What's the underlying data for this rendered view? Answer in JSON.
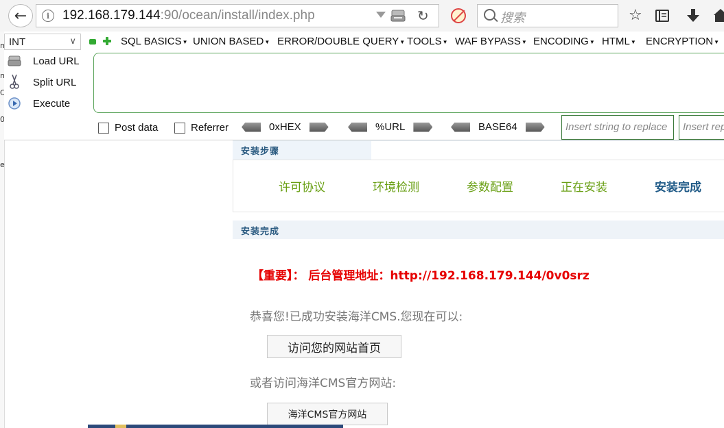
{
  "browser": {
    "url_host": "192.168.179.144",
    "url_rest": ":90/ocean/install/index.php",
    "search_placeholder": "搜索"
  },
  "hackbar": {
    "select_value": "INT",
    "menus": [
      "SQL BASICS",
      "UNION BASED",
      "ERROR/DOUBLE QUERY",
      "TOOLS",
      "WAF BYPASS",
      "ENCODING",
      "HTML",
      "ENCRYPTION"
    ],
    "load_url": "Load URL",
    "split_url": "Split URL",
    "execute": "Execute",
    "post_data": "Post data",
    "referrer": "Referrer",
    "hex": "0xHEX",
    "url_enc": "%URL",
    "base64": "BASE64",
    "insert_placeholder_1": "Insert string to replace",
    "insert_placeholder_2": "Insert replacing string"
  },
  "page": {
    "steps_title": "安装步骤",
    "steps": [
      "许可协议",
      "环境检测",
      "参数配置",
      "正在安装",
      "安装完成"
    ],
    "done_title": "安装完成",
    "admin_note": "【重要】：  后台管理地址：http://192.168.179.144/0v0srz",
    "congrats": "恭喜您!已成功安装海洋CMS.您现在可以:",
    "visit_home": "访问您的网站首页",
    "or_text": "或者访问海洋CMS官方网站:",
    "visit_official": "海洋CMS官方网站"
  },
  "colors": {
    "step_done": "#6aa015",
    "step_active": "#1f5a87",
    "admin_note": "#e60000"
  }
}
